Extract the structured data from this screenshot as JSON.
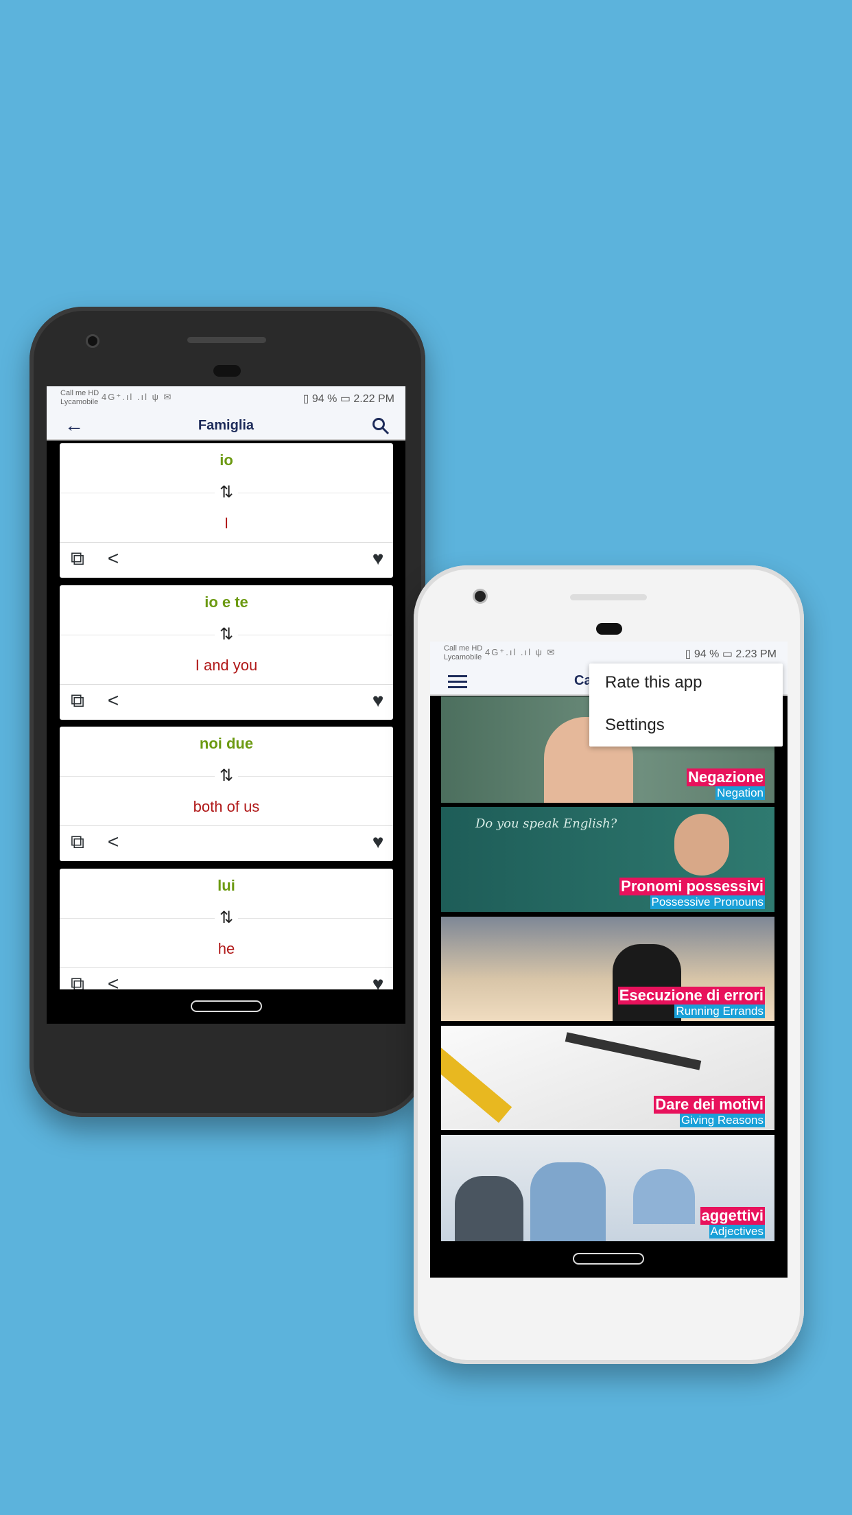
{
  "status_left": {
    "carrier_top": "Call me HD",
    "carrier_bottom": "Lycamobile",
    "signal": "4G⁺.ıl  .ıl ψ ✉",
    "battery": "94 %",
    "time": "2.22 PM"
  },
  "status_right": {
    "carrier_top": "Call me HD",
    "carrier_bottom": "Lycamobile",
    "signal": "4G⁺.ıl  .ıl ψ ✉",
    "battery": "94 %",
    "time": "2.23 PM"
  },
  "left_app": {
    "title": "Famiglia",
    "back_icon": "arrow-left-icon",
    "search_icon": "search-icon",
    "cards": [
      {
        "italian": "io",
        "english": "I"
      },
      {
        "italian": "io e te",
        "english": "I and you"
      },
      {
        "italian": "noi due",
        "english": "both of us"
      },
      {
        "italian": "lui",
        "english": "he"
      }
    ]
  },
  "right_app": {
    "title_partial": "Ca",
    "menu_icon": "hamburger-icon",
    "overflow_menu": [
      "Rate this app",
      "Settings"
    ],
    "categories": [
      {
        "italian": "Negazione",
        "english": "Negation",
        "colors": [
          "#4c6f5e",
          "#6f8f7e"
        ]
      },
      {
        "italian": "Pronomi possessivi",
        "english": "Possessive Pronouns",
        "colors": [
          "#1e5d58",
          "#2f7a70"
        ],
        "chalk_text": "Do you speak English?"
      },
      {
        "italian": "Esecuzione di errori",
        "english": "Running Errands",
        "colors": [
          "#8a8f9a",
          "#e8d2b0"
        ]
      },
      {
        "italian": "Dare dei motivi",
        "english": "Giving Reasons",
        "colors": [
          "#f2f2f2",
          "#d8d8d8"
        ]
      },
      {
        "italian": "aggettivi",
        "english": "Adjectives",
        "colors": [
          "#e6eaee",
          "#9ab0c8"
        ]
      }
    ]
  },
  "colors": {
    "background": "#5cb3dc",
    "italian_text": "#6c9a12",
    "english_text": "#b01818",
    "label_pink": "#e8125c",
    "label_blue": "#1aa0d8"
  }
}
